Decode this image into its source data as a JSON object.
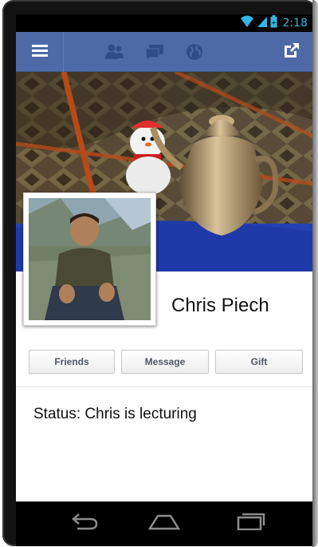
{
  "status_bar": {
    "time": "2:18",
    "icons": [
      "wifi-icon",
      "signal-icon",
      "battery-icon"
    ],
    "accent_color": "#33b5e5"
  },
  "app_bar": {
    "background_color": "#4d6aa6",
    "icons": [
      "menu-icon",
      "friend-requests-icon",
      "messages-icon",
      "notifications-globe-icon",
      "share-icon"
    ]
  },
  "profile": {
    "name": "Chris Piech",
    "status": "Status: Chris is lecturing"
  },
  "actions": {
    "friends_label": "Friends",
    "message_label": "Message",
    "gift_label": "Gift"
  },
  "navigation": {
    "icons": [
      "back-icon",
      "home-icon",
      "recent-apps-icon"
    ]
  }
}
